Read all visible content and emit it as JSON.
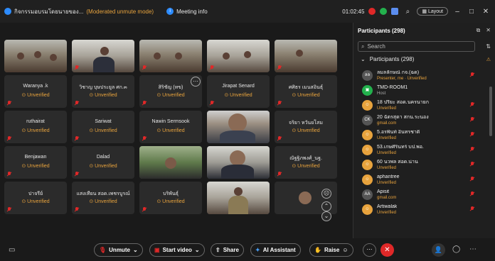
{
  "titlebar": {
    "title": "กิจกรรมอบรมโดยนายของ...",
    "mode": "(Moderated unmute mode)",
    "meeting_info": "Meeting info",
    "timer": "01:02:45",
    "layout_label": "Layout"
  },
  "tiles": [
    {
      "name": "Waranya .k",
      "status": "Unverified"
    },
    {
      "name": "วิชาญ บุษประยูล ศก.๓",
      "status": "Unverified"
    },
    {
      "name": "สิริชัญ (ทข)",
      "status": "Unverified"
    },
    {
      "name": "Jirapat Senard",
      "status": "Unverified"
    },
    {
      "name": "ศศิธร เมนสอินธุ์",
      "status": "Unverified"
    },
    {
      "name": "ruthairat",
      "status": "Unverified"
    },
    {
      "name": "Sariwat",
      "status": "Unverified"
    },
    {
      "name": "Nawin Sermsook",
      "status": "Unverified"
    },
    {
      "name": "จริยา หวันยโสม",
      "status": "Unverified"
    },
    {
      "name": "Benjawan",
      "status": "Unverified"
    },
    {
      "name": "Dalad",
      "status": "Unverified"
    },
    {
      "name": "ณัฐฐิภพงศ์_นฐ.",
      "status": "Unverified"
    },
    {
      "name": "ปาจรีย์",
      "status": "Unverified"
    },
    {
      "name": "แสงเทียน สอด.เพชรบูรณ์",
      "status": "Unverified"
    },
    {
      "name": "บริพันธุ์",
      "status": "Unverified"
    }
  ],
  "panel": {
    "title": "Participants (298)",
    "search_placeholder": "Search",
    "group_label": "Participants (298)",
    "participants": [
      {
        "initials": "ลล",
        "name": "ลมลลักษณ์ กจ.(ฉด)",
        "sub": "Presenter, me · Unverified"
      },
      {
        "initials": "",
        "name": "TMD-ROOM1",
        "sub": "Host"
      },
      {
        "initials": "",
        "name": "18 ปรียะ สอด.นครนายก",
        "sub": "Unverified"
      },
      {
        "initials": "CK",
        "name": "20 ฉัตรสุดา สกน.ระนอง",
        "sub": "gmail.com"
      },
      {
        "initials": "",
        "name": "5.อรพินท์ อินทรชาติ",
        "sub": "Unverified"
      },
      {
        "initials": "",
        "name": "53.เกษศิรินทร์ บป.พอ.",
        "sub": "Unverified"
      },
      {
        "initials": "",
        "name": "60 นวพล สอด.น่าน",
        "sub": "Unverified"
      },
      {
        "initials": "",
        "name": "aphantree",
        "sub": "Unverified"
      },
      {
        "initials": "AA",
        "name": "Apisit",
        "sub": "gmail.com"
      },
      {
        "initials": "",
        "name": "Artiwalak",
        "sub": "Unverified"
      }
    ]
  },
  "toolbar": {
    "unmute": "Unmute",
    "start_video": "Start video",
    "share": "Share",
    "ai_assistant": "AI Assistant",
    "raise": "Raise"
  },
  "colors": {
    "accent": "#2d8cff",
    "unverified": "#e8a33d",
    "danger": "#e02828"
  }
}
